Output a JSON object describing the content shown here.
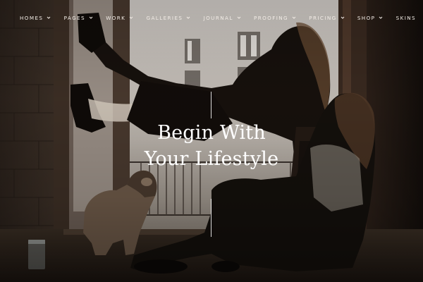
{
  "nav": {
    "items": [
      {
        "label": "Homes",
        "has_dropdown": true
      },
      {
        "label": "Pages",
        "has_dropdown": true
      },
      {
        "label": "Work",
        "has_dropdown": true
      },
      {
        "label": "Galleries",
        "has_dropdown": true
      },
      {
        "label": "Journal",
        "has_dropdown": true
      },
      {
        "label": "Proofing",
        "has_dropdown": true
      },
      {
        "label": "Pricing",
        "has_dropdown": true
      },
      {
        "label": "Shop",
        "has_dropdown": true
      },
      {
        "label": "Skins",
        "has_dropdown": false
      }
    ],
    "dropdown_icon": "chevron-down-icon"
  },
  "hero": {
    "headline_line1": "Begin With",
    "headline_line2": "Your Lifestyle"
  },
  "colors": {
    "nav_text": "#f2ece6",
    "headline_text": "#ffffff",
    "background_dark": "#1a1512"
  }
}
